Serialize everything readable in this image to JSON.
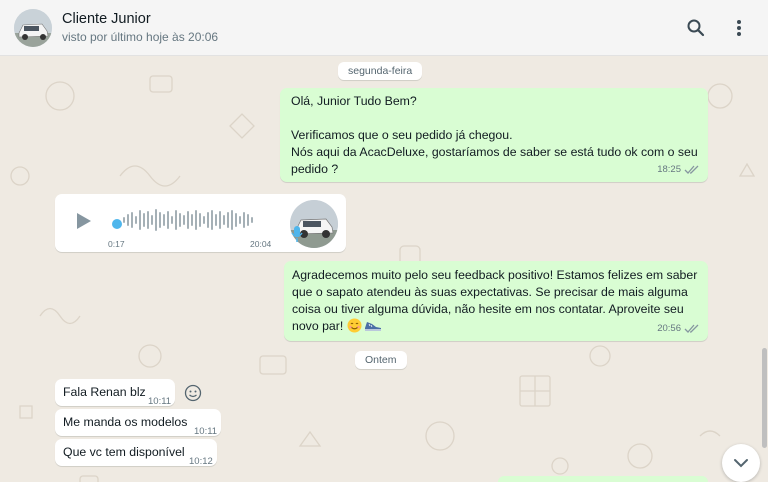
{
  "header": {
    "contact_name": "Cliente Junior",
    "status": "visto por último hoje às 20:06",
    "icons": [
      "search-icon",
      "menu-dots-icon"
    ]
  },
  "chat": {
    "day_labels": [
      "segunda-feira",
      "Ontem"
    ],
    "messages": [
      {
        "direction": "outgoing",
        "text": "Olá, Junior Tudo Bem?\n\nVerificamos que o seu pedido já chegou.\nNós aqui da AcacDeluxe, gostaríamos de saber se está tudo ok com o seu\npedido ?",
        "time": "18:25",
        "status": "read"
      },
      {
        "direction": "incoming",
        "type": "audio",
        "position": "0:17",
        "time": "20:04",
        "progress": 0.0
      },
      {
        "direction": "outgoing",
        "text": "Agradecemos muito pelo seu feedback positivo! Estamos felizes em saber\nque o sapato atendeu às suas expectativas. Se precisar de mais alguma\ncoisa ou tiver alguma dúvida, não hesite em nos contatar. Aproveite seu\nnovo par! ",
        "emojis": [
          "smiling-face",
          "sneaker"
        ],
        "time": "20:56",
        "status": "read"
      },
      {
        "direction": "incoming",
        "text": "Fala Renan blz",
        "time": "10:11"
      },
      {
        "direction": "incoming",
        "text": "Me manda os modelos",
        "time": "10:11"
      },
      {
        "direction": "incoming",
        "text": "Que vc tem disponível",
        "time": "10:12"
      }
    ]
  },
  "colors": {
    "outgoing_bubble": "#d9fdd3",
    "incoming_bubble": "#ffffff",
    "chat_background": "#efeae2",
    "read_ticks": "#8696a0",
    "audio_accent": "#4fb6ec"
  },
  "controls": {
    "scroll_down_icon": "chevron-down-icon",
    "reaction_icon": "emoji-icon"
  }
}
